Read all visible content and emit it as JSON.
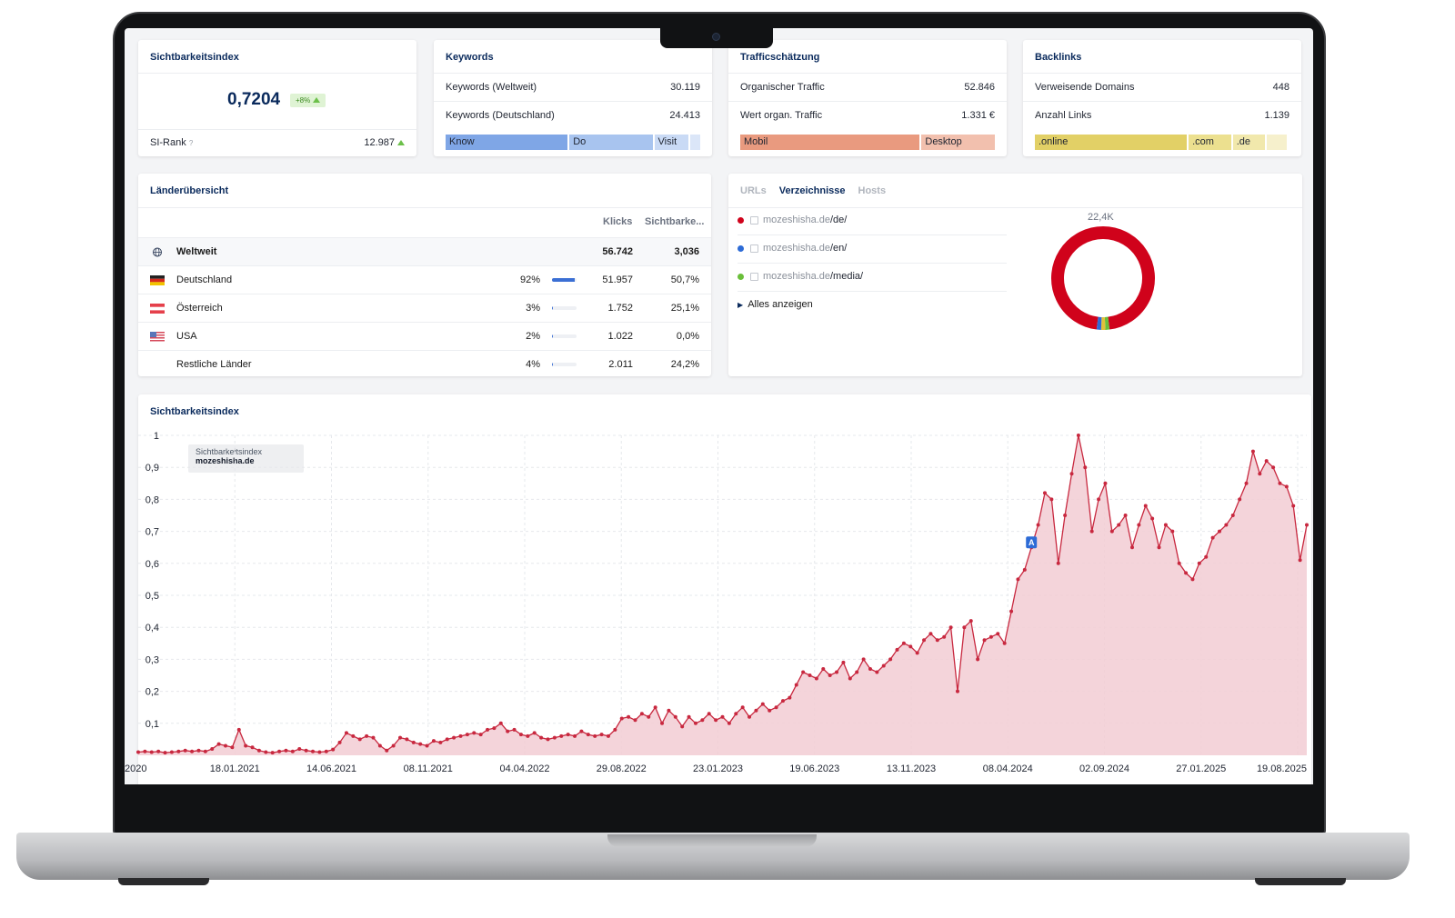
{
  "si_card": {
    "title": "Sichtbarkeitsindex",
    "value": "0,7204",
    "change": "+8%",
    "rank_label": "SI-Rank",
    "rank_help": "?",
    "rank_value": "12.987"
  },
  "keywords_card": {
    "title": "Keywords",
    "rows": [
      {
        "label": "Keywords (Weltweit)",
        "value": "30.119"
      },
      {
        "label": "Keywords (Deutschland)",
        "value": "24.413"
      }
    ],
    "segments": [
      {
        "label": "Know",
        "share": 0.5,
        "color": "#7fa6e6"
      },
      {
        "label": "Do",
        "share": 0.34,
        "color": "#a8c4ef"
      },
      {
        "label": "Visit",
        "share": 0.14,
        "color": "#c9daf5"
      },
      {
        "label": "",
        "share": 0.04,
        "color": "#dbe6f8"
      }
    ]
  },
  "traffic_card": {
    "title": "Trafficschätzung",
    "rows": [
      {
        "label": "Organischer Traffic",
        "value": "52.846"
      },
      {
        "label": "Wert organ. Traffic",
        "value": "1.331 €"
      }
    ],
    "segments": [
      {
        "label": "Mobil",
        "share": 0.71,
        "color": "#e99a7f"
      },
      {
        "label": "Desktop",
        "share": 0.29,
        "color": "#f2c0ae"
      }
    ]
  },
  "backlinks_card": {
    "title": "Backlinks",
    "rows": [
      {
        "label": "Verweisende Domains",
        "value": "448"
      },
      {
        "label": "Anzahl Links",
        "value": "1.139"
      }
    ],
    "segments": [
      {
        "label": ".online",
        "share": 0.61,
        "color": "#e2d066"
      },
      {
        "label": ".com",
        "share": 0.17,
        "color": "#ece08f"
      },
      {
        "label": ".de",
        "share": 0.13,
        "color": "#f1e8ac"
      },
      {
        "label": "",
        "share": 0.08,
        "color": "#f6f0cc"
      }
    ]
  },
  "laender": {
    "title": "Länderübersicht",
    "col_klicks": "Klicks",
    "col_sichtbarkeit": "Sichtbarke...",
    "rows": [
      {
        "country": "Weltweit",
        "pct": "",
        "share": 0,
        "klicks": "56.742",
        "si": "3,036",
        "flag": "globe-icon"
      },
      {
        "country": "Deutschland",
        "pct": "92%",
        "share": 0.92,
        "klicks": "51.957",
        "si": "50,7%",
        "flag": "flag-de-icon"
      },
      {
        "country": "Österreich",
        "pct": "3%",
        "share": 0.03,
        "klicks": "1.752",
        "si": "25,1%",
        "flag": "flag-at-icon"
      },
      {
        "country": "USA",
        "pct": "2%",
        "share": 0.02,
        "klicks": "1.022",
        "si": "0,0%",
        "flag": "flag-us-icon"
      },
      {
        "country": "Restliche Länder",
        "pct": "4%",
        "share": 0.04,
        "klicks": "2.011",
        "si": "24,2%",
        "flag": ""
      }
    ]
  },
  "directories": {
    "tabs": [
      "URLs",
      "Verzeichnisse",
      "Hosts"
    ],
    "active_tab": 1,
    "items": [
      {
        "host": "mozeshisha.de",
        "path": "/de/",
        "color": "#d0021b"
      },
      {
        "host": "mozeshisha.de",
        "path": "/en/",
        "color": "#2d6bd6"
      },
      {
        "host": "mozeshisha.de",
        "path": "/media/",
        "color": "#6abf3a"
      }
    ],
    "show_all": "Alles anzeigen",
    "donut_label": "22,4K",
    "donut_shares": [
      0.96,
      0.013,
      0.013,
      0.014
    ],
    "donut_colors": [
      "#d0021b",
      "#6abf3a",
      "#e2c13a",
      "#2d6bd6"
    ]
  },
  "main_chart": {
    "title": "Sichtbarkeitsindex",
    "legend_title": "Sichtbarkeitsindex",
    "legend_domain": "mozeshisha.de",
    "marker_label": "A"
  },
  "chart_data": {
    "type": "area",
    "title": "Sichtbarkeitsindex",
    "series": [
      {
        "name": "mozeshisha.de",
        "color": "#c8283f"
      }
    ],
    "ylim": [
      0,
      1
    ],
    "yticks": [
      "0,1",
      "0,2",
      "0,3",
      "0,4",
      "0,5",
      "0,6",
      "0,7",
      "0,8",
      "0,9",
      "1"
    ],
    "xticks": [
      "2020",
      "18.01.2021",
      "14.06.2021",
      "08.11.2021",
      "04.04.2022",
      "29.08.2022",
      "23.01.2023",
      "19.06.2023",
      "13.11.2023",
      "08.04.2024",
      "02.09.2024",
      "27.01.2025",
      "19.08.2025"
    ],
    "grid": true,
    "x_index": [
      0,
      1,
      2,
      3,
      4,
      5,
      6,
      7,
      8,
      9,
      10,
      11,
      12,
      13,
      14,
      15,
      16,
      17,
      18,
      19,
      20,
      21,
      22,
      23,
      24,
      25,
      26,
      27,
      28,
      29,
      30,
      31,
      32,
      33,
      34,
      35,
      36,
      37,
      38,
      39,
      40,
      41,
      42,
      43,
      44,
      45,
      46,
      47,
      48,
      49,
      50,
      51,
      52,
      53,
      54,
      55,
      56,
      57,
      58,
      59,
      60,
      61,
      62,
      63,
      64,
      65,
      66,
      67,
      68,
      69,
      70,
      71,
      72,
      73,
      74,
      75,
      76,
      77,
      78,
      79,
      80,
      81,
      82,
      83,
      84,
      85,
      86,
      87,
      88,
      89,
      90,
      91,
      92,
      93,
      94,
      95,
      96,
      97,
      98,
      99,
      100,
      101,
      102,
      103,
      104,
      105,
      106,
      107,
      108,
      109,
      110,
      111,
      112,
      113,
      114,
      115,
      116,
      117,
      118,
      119,
      120,
      121,
      122,
      123,
      124,
      125,
      126,
      127,
      128,
      129,
      130,
      131,
      132,
      133,
      134,
      135,
      136,
      137,
      138,
      139,
      140,
      141,
      142,
      143,
      144,
      145,
      146,
      147,
      148,
      149,
      150,
      151,
      152,
      153,
      154,
      155,
      156,
      157,
      158,
      159,
      160,
      161,
      162,
      163,
      164,
      165,
      166,
      167,
      168,
      169,
      170
    ],
    "values": [
      0.01,
      0.012,
      0.01,
      0.012,
      0.008,
      0.01,
      0.012,
      0.015,
      0.012,
      0.015,
      0.012,
      0.02,
      0.035,
      0.03,
      0.025,
      0.08,
      0.03,
      0.025,
      0.015,
      0.01,
      0.008,
      0.012,
      0.015,
      0.012,
      0.02,
      0.015,
      0.012,
      0.01,
      0.012,
      0.018,
      0.04,
      0.07,
      0.06,
      0.05,
      0.06,
      0.055,
      0.03,
      0.015,
      0.03,
      0.055,
      0.05,
      0.04,
      0.035,
      0.03,
      0.045,
      0.04,
      0.05,
      0.055,
      0.06,
      0.065,
      0.07,
      0.065,
      0.08,
      0.085,
      0.1,
      0.075,
      0.08,
      0.065,
      0.06,
      0.07,
      0.055,
      0.05,
      0.055,
      0.06,
      0.065,
      0.06,
      0.075,
      0.065,
      0.06,
      0.065,
      0.06,
      0.08,
      0.115,
      0.12,
      0.11,
      0.13,
      0.12,
      0.15,
      0.1,
      0.14,
      0.12,
      0.09,
      0.12,
      0.1,
      0.11,
      0.13,
      0.11,
      0.12,
      0.1,
      0.13,
      0.15,
      0.12,
      0.14,
      0.16,
      0.14,
      0.15,
      0.17,
      0.18,
      0.22,
      0.26,
      0.25,
      0.24,
      0.27,
      0.25,
      0.26,
      0.29,
      0.24,
      0.26,
      0.3,
      0.27,
      0.26,
      0.28,
      0.3,
      0.33,
      0.35,
      0.34,
      0.32,
      0.36,
      0.38,
      0.36,
      0.37,
      0.4,
      0.2,
      0.4,
      0.42,
      0.3,
      0.36,
      0.37,
      0.38,
      0.35,
      0.45,
      0.55,
      0.58,
      0.65,
      0.72,
      0.82,
      0.8,
      0.6,
      0.75,
      0.88,
      1.0,
      0.9,
      0.7,
      0.8,
      0.85,
      0.7,
      0.72,
      0.75,
      0.65,
      0.72,
      0.78,
      0.74,
      0.65,
      0.72,
      0.7,
      0.6,
      0.57,
      0.55,
      0.6,
      0.62,
      0.68,
      0.7,
      0.72,
      0.75,
      0.8,
      0.85,
      0.95,
      0.88,
      0.92,
      0.9,
      0.85,
      0.84,
      0.78,
      0.61,
      0.72
    ]
  }
}
